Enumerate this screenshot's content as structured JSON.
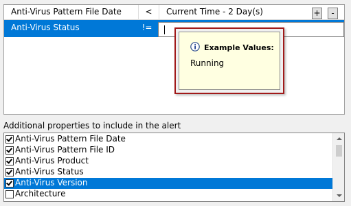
{
  "filter_grid": {
    "rows": [
      {
        "property": "Anti-Virus Pattern File Date",
        "operator": "<",
        "value": "Current Time - 2 Day(s)"
      },
      {
        "property": "Anti-Virus Status",
        "operator": "!=",
        "value": ""
      }
    ],
    "plus_label": "+",
    "minus_label": "-"
  },
  "tooltip": {
    "title": "Example Values:",
    "value": "Running",
    "icon": "info-icon"
  },
  "properties_section": {
    "label": "Additional properties to include in the alert",
    "items": [
      {
        "label": "Anti-Virus Pattern File Date",
        "checked": true
      },
      {
        "label": "Anti-Virus Pattern File ID",
        "checked": true
      },
      {
        "label": "Anti-Virus Product",
        "checked": true
      },
      {
        "label": "Anti-Virus Status",
        "checked": true
      },
      {
        "label": "Anti-Virus Version",
        "checked": true,
        "selected": true
      },
      {
        "label": "Architecture",
        "checked": false
      }
    ]
  },
  "colors": {
    "selection": "#0078d7",
    "tooltip_bg": "#ffffe1",
    "highlight_frame": "#a11a1a"
  }
}
